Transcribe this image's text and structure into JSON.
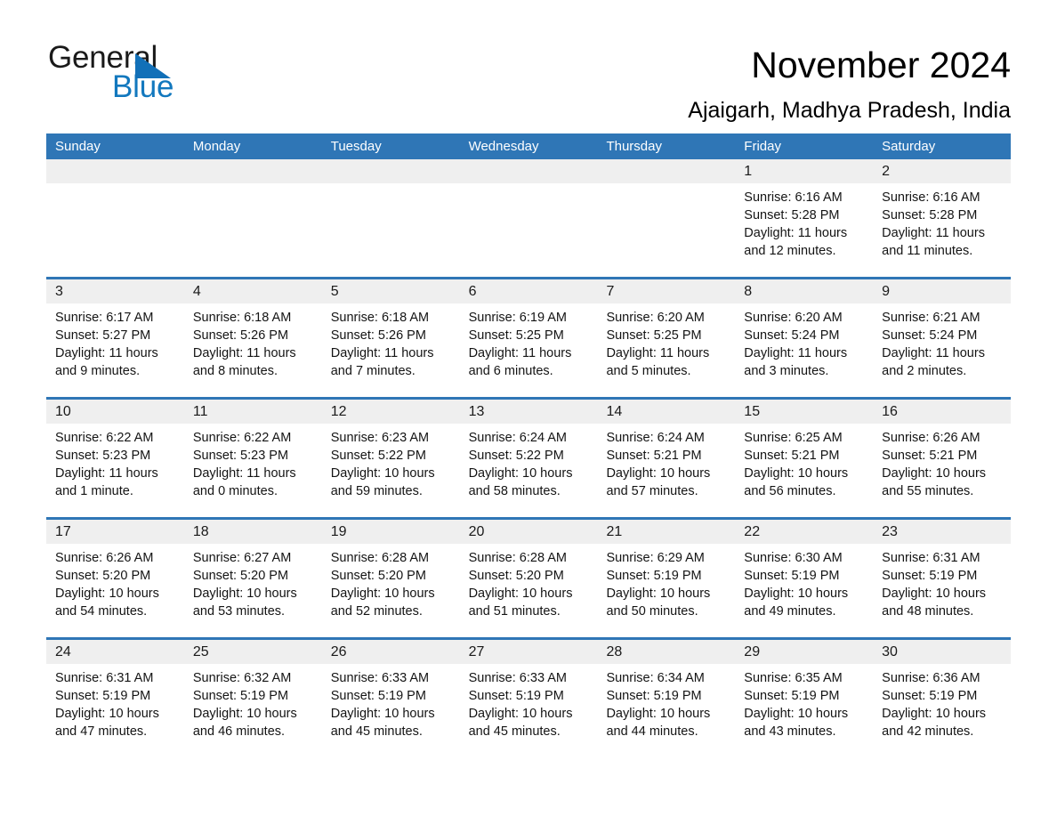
{
  "brand": {
    "name_part1": "General",
    "name_part2": "Blue",
    "logo_icon": "triangle-logo-icon",
    "accent_color": "#1270b8"
  },
  "header": {
    "title": "November 2024",
    "subtitle": "Ajaigarh, Madhya Pradesh, India"
  },
  "colors": {
    "header_blue": "#2f76b6",
    "date_band_gray": "#efefef",
    "text": "#141414"
  },
  "calendar": {
    "month": "November",
    "year": "2024",
    "weekdays": [
      "Sunday",
      "Monday",
      "Tuesday",
      "Wednesday",
      "Thursday",
      "Friday",
      "Saturday"
    ],
    "weeks": [
      {
        "days": [
          {
            "date": "",
            "empty": true,
            "sunrise": "",
            "sunset": "",
            "daylight_line1": "",
            "daylight_line2": ""
          },
          {
            "date": "",
            "empty": true,
            "sunrise": "",
            "sunset": "",
            "daylight_line1": "",
            "daylight_line2": ""
          },
          {
            "date": "",
            "empty": true,
            "sunrise": "",
            "sunset": "",
            "daylight_line1": "",
            "daylight_line2": ""
          },
          {
            "date": "",
            "empty": true,
            "sunrise": "",
            "sunset": "",
            "daylight_line1": "",
            "daylight_line2": ""
          },
          {
            "date": "",
            "empty": true,
            "sunrise": "",
            "sunset": "",
            "daylight_line1": "",
            "daylight_line2": ""
          },
          {
            "date": "1",
            "sunrise": "Sunrise: 6:16 AM",
            "sunset": "Sunset: 5:28 PM",
            "daylight_line1": "Daylight: 11 hours",
            "daylight_line2": "and 12 minutes."
          },
          {
            "date": "2",
            "sunrise": "Sunrise: 6:16 AM",
            "sunset": "Sunset: 5:28 PM",
            "daylight_line1": "Daylight: 11 hours",
            "daylight_line2": "and 11 minutes."
          }
        ]
      },
      {
        "days": [
          {
            "date": "3",
            "sunrise": "Sunrise: 6:17 AM",
            "sunset": "Sunset: 5:27 PM",
            "daylight_line1": "Daylight: 11 hours",
            "daylight_line2": "and 9 minutes."
          },
          {
            "date": "4",
            "sunrise": "Sunrise: 6:18 AM",
            "sunset": "Sunset: 5:26 PM",
            "daylight_line1": "Daylight: 11 hours",
            "daylight_line2": "and 8 minutes."
          },
          {
            "date": "5",
            "sunrise": "Sunrise: 6:18 AM",
            "sunset": "Sunset: 5:26 PM",
            "daylight_line1": "Daylight: 11 hours",
            "daylight_line2": "and 7 minutes."
          },
          {
            "date": "6",
            "sunrise": "Sunrise: 6:19 AM",
            "sunset": "Sunset: 5:25 PM",
            "daylight_line1": "Daylight: 11 hours",
            "daylight_line2": "and 6 minutes."
          },
          {
            "date": "7",
            "sunrise": "Sunrise: 6:20 AM",
            "sunset": "Sunset: 5:25 PM",
            "daylight_line1": "Daylight: 11 hours",
            "daylight_line2": "and 5 minutes."
          },
          {
            "date": "8",
            "sunrise": "Sunrise: 6:20 AM",
            "sunset": "Sunset: 5:24 PM",
            "daylight_line1": "Daylight: 11 hours",
            "daylight_line2": "and 3 minutes."
          },
          {
            "date": "9",
            "sunrise": "Sunrise: 6:21 AM",
            "sunset": "Sunset: 5:24 PM",
            "daylight_line1": "Daylight: 11 hours",
            "daylight_line2": "and 2 minutes."
          }
        ]
      },
      {
        "days": [
          {
            "date": "10",
            "sunrise": "Sunrise: 6:22 AM",
            "sunset": "Sunset: 5:23 PM",
            "daylight_line1": "Daylight: 11 hours",
            "daylight_line2": "and 1 minute."
          },
          {
            "date": "11",
            "sunrise": "Sunrise: 6:22 AM",
            "sunset": "Sunset: 5:23 PM",
            "daylight_line1": "Daylight: 11 hours",
            "daylight_line2": "and 0 minutes."
          },
          {
            "date": "12",
            "sunrise": "Sunrise: 6:23 AM",
            "sunset": "Sunset: 5:22 PM",
            "daylight_line1": "Daylight: 10 hours",
            "daylight_line2": "and 59 minutes."
          },
          {
            "date": "13",
            "sunrise": "Sunrise: 6:24 AM",
            "sunset": "Sunset: 5:22 PM",
            "daylight_line1": "Daylight: 10 hours",
            "daylight_line2": "and 58 minutes."
          },
          {
            "date": "14",
            "sunrise": "Sunrise: 6:24 AM",
            "sunset": "Sunset: 5:21 PM",
            "daylight_line1": "Daylight: 10 hours",
            "daylight_line2": "and 57 minutes."
          },
          {
            "date": "15",
            "sunrise": "Sunrise: 6:25 AM",
            "sunset": "Sunset: 5:21 PM",
            "daylight_line1": "Daylight: 10 hours",
            "daylight_line2": "and 56 minutes."
          },
          {
            "date": "16",
            "sunrise": "Sunrise: 6:26 AM",
            "sunset": "Sunset: 5:21 PM",
            "daylight_line1": "Daylight: 10 hours",
            "daylight_line2": "and 55 minutes."
          }
        ]
      },
      {
        "days": [
          {
            "date": "17",
            "sunrise": "Sunrise: 6:26 AM",
            "sunset": "Sunset: 5:20 PM",
            "daylight_line1": "Daylight: 10 hours",
            "daylight_line2": "and 54 minutes."
          },
          {
            "date": "18",
            "sunrise": "Sunrise: 6:27 AM",
            "sunset": "Sunset: 5:20 PM",
            "daylight_line1": "Daylight: 10 hours",
            "daylight_line2": "and 53 minutes."
          },
          {
            "date": "19",
            "sunrise": "Sunrise: 6:28 AM",
            "sunset": "Sunset: 5:20 PM",
            "daylight_line1": "Daylight: 10 hours",
            "daylight_line2": "and 52 minutes."
          },
          {
            "date": "20",
            "sunrise": "Sunrise: 6:28 AM",
            "sunset": "Sunset: 5:20 PM",
            "daylight_line1": "Daylight: 10 hours",
            "daylight_line2": "and 51 minutes."
          },
          {
            "date": "21",
            "sunrise": "Sunrise: 6:29 AM",
            "sunset": "Sunset: 5:19 PM",
            "daylight_line1": "Daylight: 10 hours",
            "daylight_line2": "and 50 minutes."
          },
          {
            "date": "22",
            "sunrise": "Sunrise: 6:30 AM",
            "sunset": "Sunset: 5:19 PM",
            "daylight_line1": "Daylight: 10 hours",
            "daylight_line2": "and 49 minutes."
          },
          {
            "date": "23",
            "sunrise": "Sunrise: 6:31 AM",
            "sunset": "Sunset: 5:19 PM",
            "daylight_line1": "Daylight: 10 hours",
            "daylight_line2": "and 48 minutes."
          }
        ]
      },
      {
        "days": [
          {
            "date": "24",
            "sunrise": "Sunrise: 6:31 AM",
            "sunset": "Sunset: 5:19 PM",
            "daylight_line1": "Daylight: 10 hours",
            "daylight_line2": "and 47 minutes."
          },
          {
            "date": "25",
            "sunrise": "Sunrise: 6:32 AM",
            "sunset": "Sunset: 5:19 PM",
            "daylight_line1": "Daylight: 10 hours",
            "daylight_line2": "and 46 minutes."
          },
          {
            "date": "26",
            "sunrise": "Sunrise: 6:33 AM",
            "sunset": "Sunset: 5:19 PM",
            "daylight_line1": "Daylight: 10 hours",
            "daylight_line2": "and 45 minutes."
          },
          {
            "date": "27",
            "sunrise": "Sunrise: 6:33 AM",
            "sunset": "Sunset: 5:19 PM",
            "daylight_line1": "Daylight: 10 hours",
            "daylight_line2": "and 45 minutes."
          },
          {
            "date": "28",
            "sunrise": "Sunrise: 6:34 AM",
            "sunset": "Sunset: 5:19 PM",
            "daylight_line1": "Daylight: 10 hours",
            "daylight_line2": "and 44 minutes."
          },
          {
            "date": "29",
            "sunrise": "Sunrise: 6:35 AM",
            "sunset": "Sunset: 5:19 PM",
            "daylight_line1": "Daylight: 10 hours",
            "daylight_line2": "and 43 minutes."
          },
          {
            "date": "30",
            "sunrise": "Sunrise: 6:36 AM",
            "sunset": "Sunset: 5:19 PM",
            "daylight_line1": "Daylight: 10 hours",
            "daylight_line2": "and 42 minutes."
          }
        ]
      }
    ]
  }
}
